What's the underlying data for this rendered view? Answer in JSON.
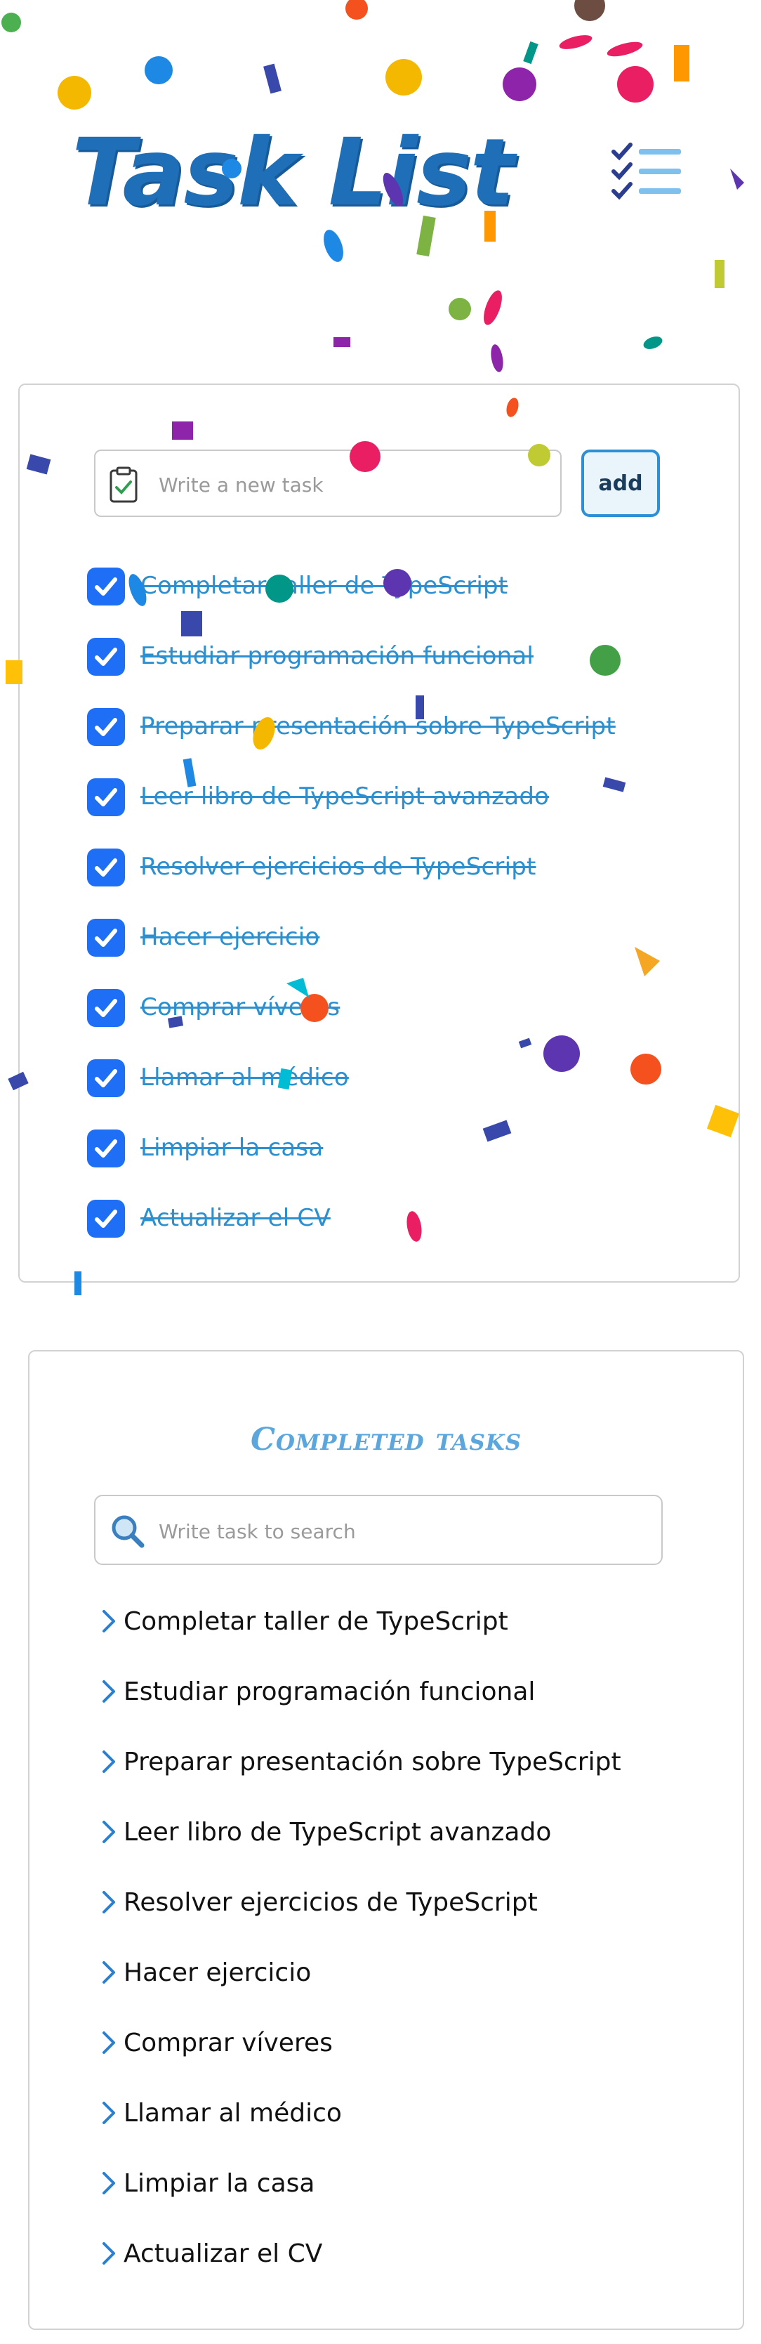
{
  "app": {
    "title": "Task List",
    "accent_color": "#1e6ff5",
    "title_color": "#1f6fb8"
  },
  "new_task": {
    "placeholder": "Write a new task",
    "add_label": "add",
    "icon": "clipboard-check-icon"
  },
  "tasks": [
    {
      "label": "Completar taller de TypeScript",
      "done": true
    },
    {
      "label": "Estudiar programación funcional",
      "done": true
    },
    {
      "label": "Preparar presentación sobre TypeScript",
      "done": true
    },
    {
      "label": "Leer libro de TypeScript avanzado",
      "done": true
    },
    {
      "label": "Resolver ejercicios de TypeScript",
      "done": true
    },
    {
      "label": "Hacer ejercicio",
      "done": true
    },
    {
      "label": "Comprar víveres",
      "done": true
    },
    {
      "label": "Llamar al médico",
      "done": true
    },
    {
      "label": "Limpiar la casa",
      "done": true
    },
    {
      "label": "Actualizar el CV",
      "done": true
    }
  ],
  "completed": {
    "title": "Completed tasks",
    "search_placeholder": "Write task to search",
    "search_icon": "magnifier-icon",
    "items": [
      "Completar taller de TypeScript",
      "Estudiar programación funcional",
      "Preparar presentación sobre TypeScript",
      "Leer libro de TypeScript avanzado",
      "Resolver ejercicios de TypeScript",
      "Hacer ejercicio",
      "Comprar víveres",
      "Llamar al médico",
      "Limpiar la casa",
      "Actualizar el CV"
    ]
  }
}
